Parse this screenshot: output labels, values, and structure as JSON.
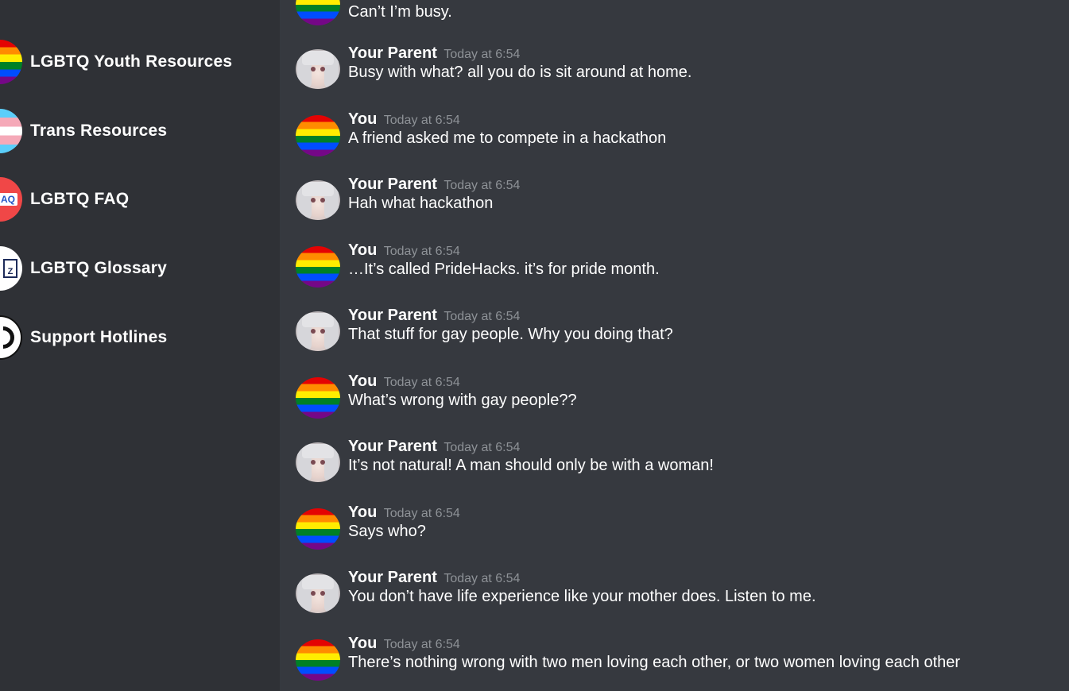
{
  "sidebar": {
    "items": [
      {
        "label": "LGBTQ Youth Resources",
        "icon": "rainbow-flag-icon"
      },
      {
        "label": "Trans Resources",
        "icon": "trans-flag-icon"
      },
      {
        "label": "LGBTQ FAQ",
        "icon": "faq-icon",
        "icon_text": "AQ"
      },
      {
        "label": "LGBTQ Glossary",
        "icon": "glossary-book-icon",
        "icon_text": "Z"
      },
      {
        "label": "Support Hotlines",
        "icon": "phone-icon"
      }
    ]
  },
  "chat": {
    "messages": [
      {
        "author": "",
        "time": "",
        "text": "Can’t I’m busy.",
        "avatar": "rainbow"
      },
      {
        "author": "Your Parent",
        "time": "Today at 6:54",
        "text": "Busy with what? all you do is sit around at home.",
        "avatar": "parent"
      },
      {
        "author": "You",
        "time": "Today at 6:54",
        "text": "A friend asked me to compete in a hackathon",
        "avatar": "rainbow"
      },
      {
        "author": "Your Parent",
        "time": "Today at 6:54",
        "text": "Hah what hackathon",
        "avatar": "parent"
      },
      {
        "author": "You",
        "time": "Today at 6:54",
        "text": "…It’s called PrideHacks. it’s for pride month.",
        "avatar": "rainbow"
      },
      {
        "author": "Your Parent",
        "time": "Today at 6:54",
        "text": "That stuff for gay people. Why you doing that?",
        "avatar": "parent"
      },
      {
        "author": "You",
        "time": "Today at 6:54",
        "text": "What’s wrong with gay people??",
        "avatar": "rainbow"
      },
      {
        "author": "Your Parent",
        "time": "Today at 6:54",
        "text": "It’s not natural! A man should only be with a woman!",
        "avatar": "parent"
      },
      {
        "author": "You",
        "time": "Today at 6:54",
        "text": "Says who?",
        "avatar": "rainbow"
      },
      {
        "author": "Your Parent",
        "time": "Today at 6:54",
        "text": "You don’t have life experience like your mother does. Listen to me.",
        "avatar": "parent"
      },
      {
        "author": "You",
        "time": "Today at 6:54",
        "text": "There’s nothing wrong with two men loving each other, or two women loving each other",
        "avatar": "rainbow"
      }
    ]
  },
  "colors": {
    "sidebar_bg": "#2f3136",
    "chat_bg": "#36393f",
    "timestamp": "#8e9297",
    "text": "#ffffff"
  }
}
